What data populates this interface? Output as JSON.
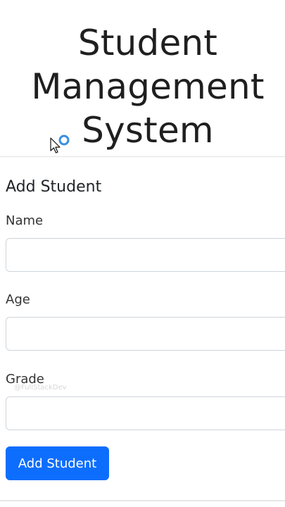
{
  "header": {
    "title_line1": "Student",
    "title_line2": "Management",
    "title_line3": "System"
  },
  "form": {
    "title": "Add Student",
    "fields": [
      {
        "label": "Name",
        "value": "",
        "placeholder": ""
      },
      {
        "label": "Age",
        "value": "",
        "placeholder": ""
      },
      {
        "label": "Grade",
        "value": "",
        "placeholder": ""
      }
    ],
    "submit_label": "Add Student"
  },
  "watermark": "@FullStackDev",
  "colors": {
    "primary": "#0d6efd",
    "input_border": "#ced4da",
    "text": "#212529",
    "busy_ring": "#3b8fe0"
  },
  "icons": {
    "cursor": "busy-pointer-icon"
  }
}
